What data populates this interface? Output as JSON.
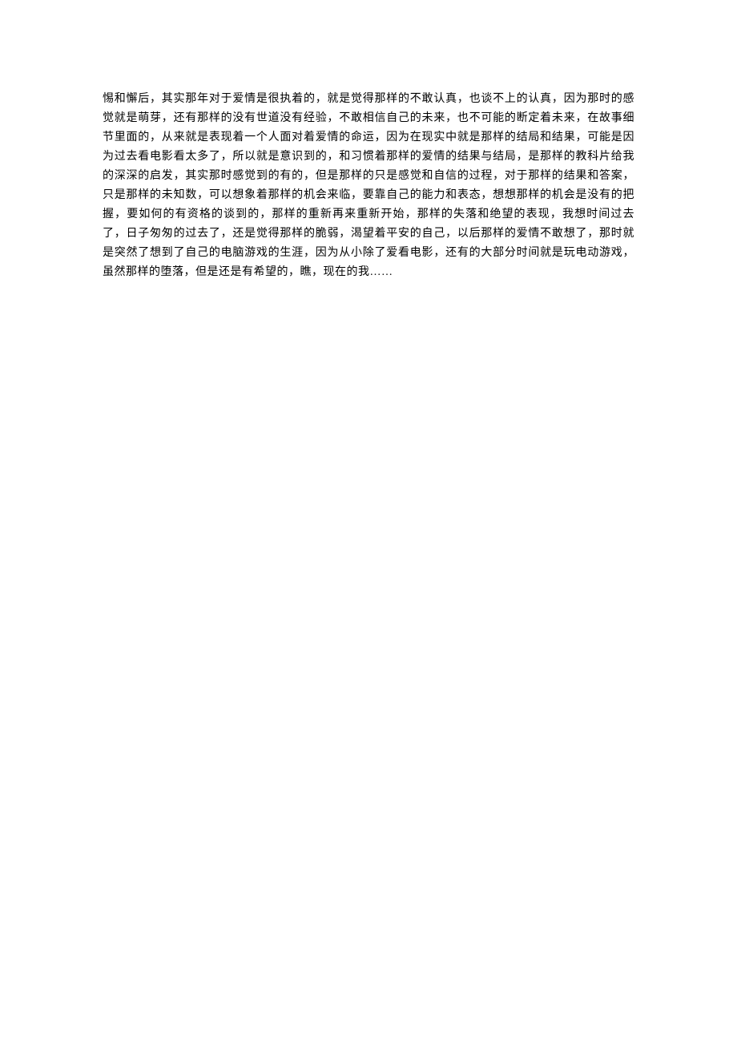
{
  "content": {
    "paragraph": "惕和懈后，其实那年对于爱情是很执着的，就是觉得那样的不敢认真，也谈不上的认真，因为那时的感觉就是萌芽，还有那样的没有世道没有经验，不敢相信自己的未来，也不可能的断定着未来，在故事细节里面的，从来就是表现着一个人面对着爱情的命运，因为在现实中就是那样的结局和结果，可能是因为过去看电影看太多了，所以就是意识到的，和习惯着那样的爱情的结果与结局，是那样的教科片给我的深深的启发，其实那时感觉到的有的，但是那样的只是感觉和自信的过程，对于那样的结果和答案，只是那样的未知数，可以想象着那样的机会来临，要靠自己的能力和表态，想想那样的机会是没有的把握，要如何的有资格的谈到的，那样的重新再来重新开始，那样的失落和绝望的表现，我想时间过去了，日子匆匆的过去了，还是觉得那样的脆弱，渴望着平安的自己，以后那样的爱情不敢想了，那时就是突然了想到了自己的电脑游戏的生涯，因为从小除了爱看电影，还有的大部分时间就是玩电动游戏，虽然那样的堕落，但是还是有希望的，瞧，现在的我……"
  }
}
